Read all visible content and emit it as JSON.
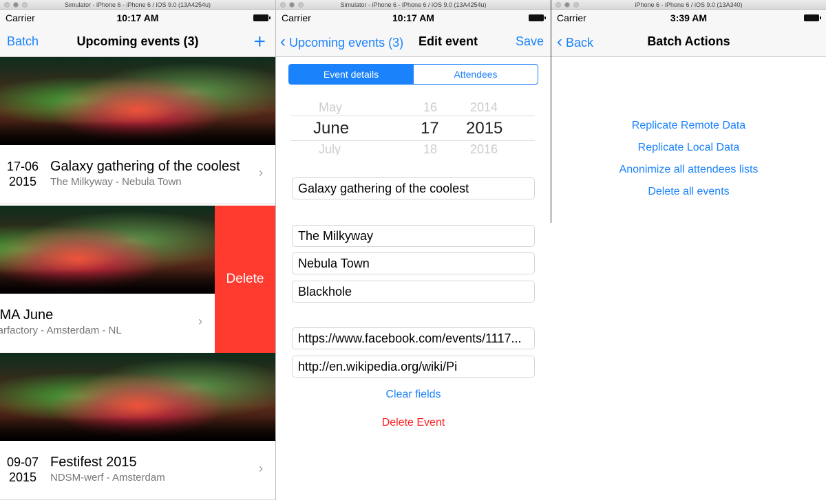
{
  "panel1": {
    "window_title": "Simulator - iPhone 6 - iPhone 6 / iOS 9.0 (13A4254u)",
    "carrier": "Carrier",
    "time": "10:17 AM",
    "nav": {
      "left": "Batch",
      "title": "Upcoming events (3)",
      "right": "+"
    },
    "events": [
      {
        "date_day": "17-06",
        "date_year": "2015",
        "title": "Galaxy gathering of the coolest",
        "subtitle": "The Milkyway - Nebula Town"
      },
      {
        "date_day": "",
        "date_year": "",
        "title": "UMA June",
        "subtitle": "igarfactory - Amsterdam - NL"
      },
      {
        "date_day": "09-07",
        "date_year": "2015",
        "title": "Festifest 2015",
        "subtitle": "NDSM-werf - Amsterdam"
      }
    ],
    "delete_label": "Delete",
    "delete_color": "#FF3B30"
  },
  "panel2": {
    "window_title": "Simulator - iPhone 6 - iPhone 6 / iOS 9.0 (13A4254u)",
    "carrier": "Carrier",
    "time": "10:17 AM",
    "nav": {
      "back": "Upcoming events (3)",
      "title": "Edit event",
      "right": "Save"
    },
    "segments": [
      "Event details",
      "Attendees"
    ],
    "picker": {
      "month_prev": "May",
      "month": "June",
      "month_next": "July",
      "day_prev": "16",
      "day": "17",
      "day_next": "18",
      "year_prev": "2014",
      "year": "2015",
      "year_next": "2016"
    },
    "fields": {
      "name": "Galaxy gathering of the coolest",
      "location": "The Milkyway",
      "city": "Nebula Town",
      "venue": "Blackhole",
      "facebook": "https://www.facebook.com/events/1117...",
      "wiki": "http://en.wikipedia.org/wiki/Pi"
    },
    "clear_label": "Clear fields",
    "delete_label": "Delete Event"
  },
  "panel3": {
    "window_title": "iPhone 6 - iPhone 6 / iOS 9.0 (13A340)",
    "carrier": "Carrier",
    "time": "3:39 AM",
    "nav": {
      "back": "Back",
      "title": "Batch Actions"
    },
    "actions": [
      "Replicate Remote Data",
      "Replicate Local Data",
      "Anonimize all attendees lists",
      "Delete all events"
    ]
  },
  "accent": "#1a82fb"
}
